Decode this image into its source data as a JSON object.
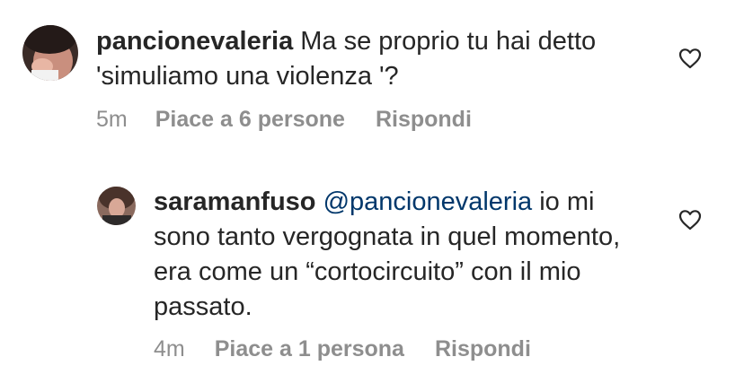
{
  "comments": [
    {
      "username": "pancionevaleria",
      "text": " Ma se proprio tu hai detto 'simuliamo una violenza '?",
      "time": "5m",
      "likes": "Piace a 6 persone",
      "reply": "Rispondi"
    },
    {
      "username": "saramanfuso",
      "mention": "@pancionevaleria",
      "text": " io mi sono tanto vergognata in quel momento, era come un “cortocircuito” con il mio passato.",
      "time": "4m",
      "likes": "Piace a 1 persona",
      "reply": "Rispondi"
    }
  ],
  "icons": {
    "like": "heart-outline-icon"
  },
  "colors": {
    "text": "#262626",
    "muted": "#8e8e8e",
    "mention": "#00376b"
  }
}
